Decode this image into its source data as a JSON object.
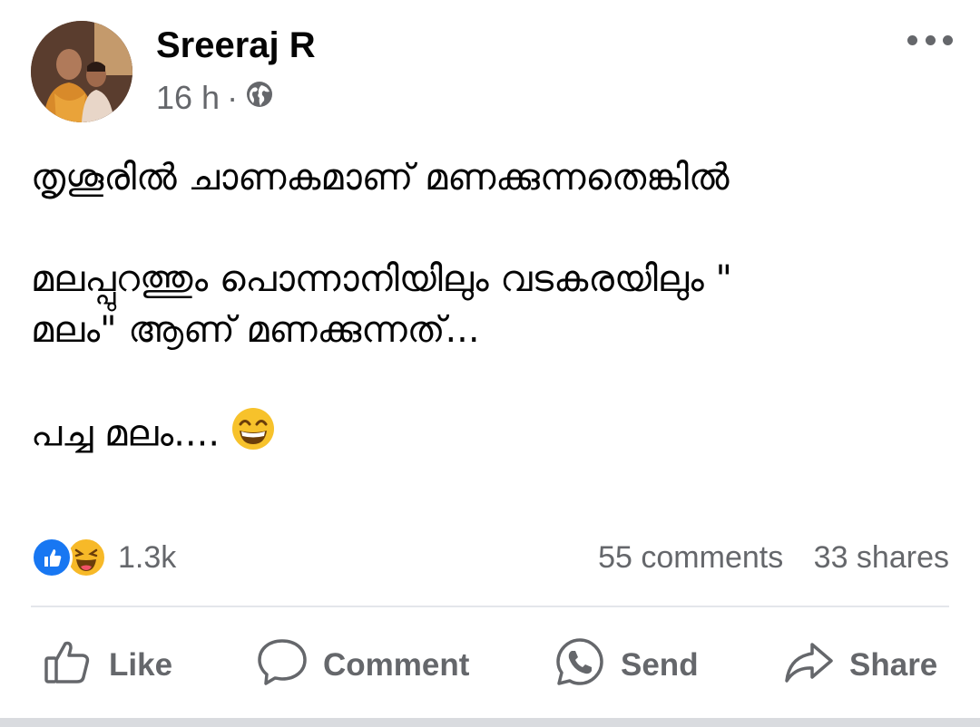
{
  "post": {
    "author": "Sreeraj R",
    "time": "16 h",
    "separator": "·",
    "privacy_icon": "globe-icon",
    "more_icon": "more-options-icon",
    "lines": [
      "തൃശൂരിൽ ചാണകമാണ്  മണക്കുന്നതെങ്കിൽ",
      "മലപ്പുറത്തും പൊന്നാനിയിലും വടകരയിലും \"",
      "മലം\" ആണ് മണക്കുന്നത്...",
      "പച്ച മലം...."
    ],
    "emoji": "grinning-face-with-smiling-eyes"
  },
  "stats": {
    "reactions_count": "1.3k",
    "comments": "55 comments",
    "shares": "33 shares",
    "reaction_icons": [
      "like-icon",
      "haha-icon"
    ]
  },
  "actions": {
    "like": "Like",
    "comment": "Comment",
    "send": "Send",
    "share": "Share"
  },
  "colors": {
    "secondary_text": "#65676b",
    "primary_text": "#050505",
    "like_blue": "#1877f2",
    "haha_yellow": "#f7b928",
    "divider": "#e4e6eb"
  }
}
